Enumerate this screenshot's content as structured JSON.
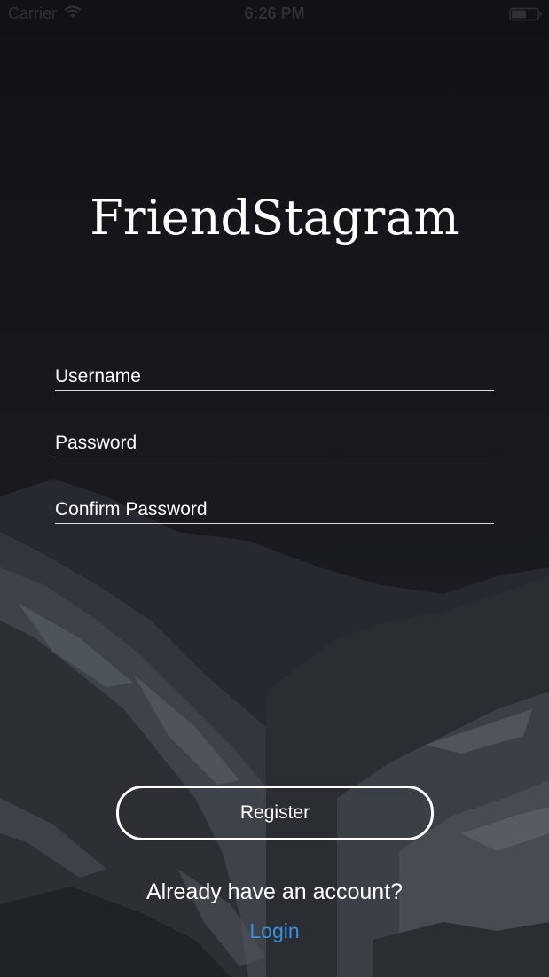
{
  "status_bar": {
    "carrier": "Carrier",
    "time": "6:26 PM",
    "wifi_icon": "wifi-icon",
    "battery_icon": "battery-icon"
  },
  "app": {
    "title": "FriendStagram"
  },
  "form": {
    "username_placeholder": "Username",
    "username_value": "",
    "password_placeholder": "Password",
    "password_value": "",
    "confirm_password_placeholder": "Confirm Password",
    "confirm_password_value": "",
    "register_label": "Register"
  },
  "footer": {
    "account_text": "Already have an account?",
    "login_label": "Login"
  },
  "colors": {
    "background": "#15171b",
    "text": "#ffffff",
    "link": "#3a8fe0",
    "field_underline": "#d8dade"
  }
}
